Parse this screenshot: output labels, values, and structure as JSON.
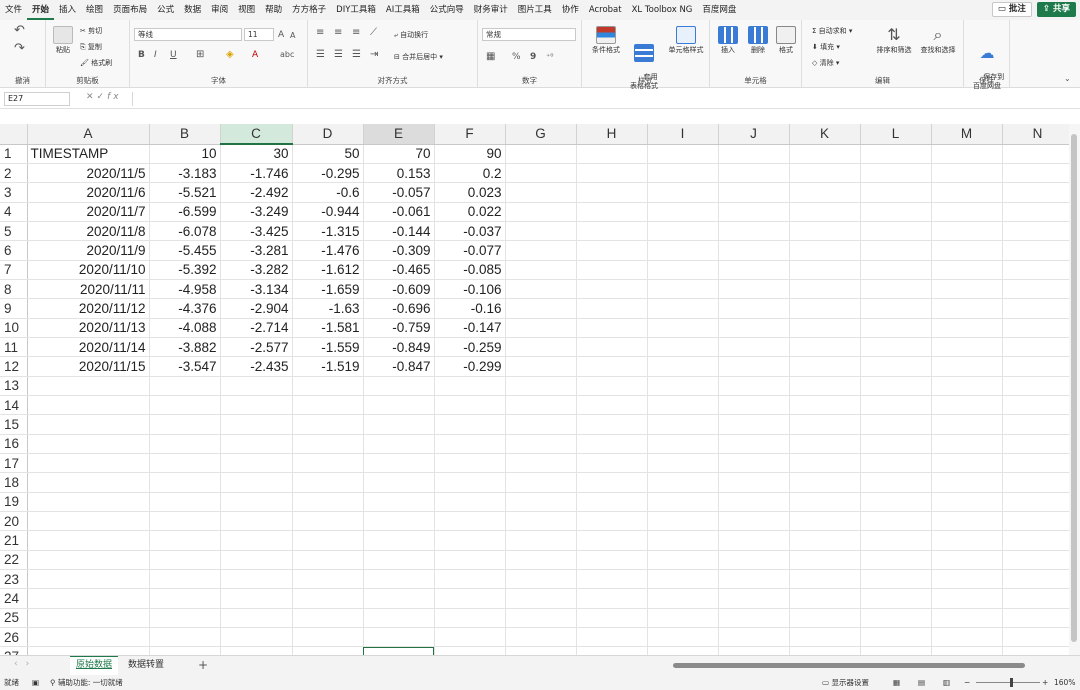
{
  "menu": {
    "tabs": [
      "文件",
      "开始",
      "插入",
      "绘图",
      "页面布局",
      "公式",
      "数据",
      "审阅",
      "视图",
      "帮助",
      "方方格子",
      "DIY工具箱",
      "AI工具箱",
      "公式向导",
      "财务审计",
      "图片工具",
      "协作",
      "Acrobat",
      "XL Toolbox NG",
      "百度网盘"
    ],
    "active": "开始",
    "comment_label": "批注",
    "share_label": "共享"
  },
  "ribbon": {
    "groups": {
      "undo": "撤消",
      "clipboard": "剪贴板",
      "font": "字体",
      "alignment": "对齐方式",
      "number": "数字",
      "styles": "样式",
      "cells": "单元格",
      "editing": "编辑",
      "save": "保存"
    },
    "clipboard": {
      "paste": "粘贴",
      "cut": "剪切",
      "copy": "复制",
      "format_painter": "格式刷"
    },
    "font": {
      "family": "等线",
      "size": "11",
      "grow": "A",
      "shrink": "A",
      "bold": "B",
      "italic": "I",
      "underline": "U",
      "color": "A"
    },
    "alignment": {
      "wrap": "自动换行",
      "merge": "合并后居中"
    },
    "number": {
      "format": "常规",
      "percent": "%",
      "comma": "9"
    },
    "styles": {
      "conditional": "条件格式",
      "table_format": "套用\n表格格式",
      "cell_styles": "单元格样式"
    },
    "cells": {
      "insert": "插入",
      "delete": "删除",
      "format": "格式"
    },
    "editing": {
      "autosum": "自动求和",
      "fill": "填充",
      "clear": "清除",
      "sort": "排序和筛选",
      "find": "查找和选择"
    },
    "save": {
      "save_to": "保存到\n百度网盘"
    }
  },
  "formula_bar": {
    "name_box": "E27",
    "fx": "fx",
    "content": ""
  },
  "columns": [
    "A",
    "B",
    "C",
    "D",
    "E",
    "F",
    "G",
    "H",
    "I",
    "J",
    "K",
    "L",
    "M",
    "N"
  ],
  "row_numbers": [
    "1",
    "2",
    "3",
    "4",
    "5",
    "6",
    "7",
    "8",
    "9",
    "10",
    "11",
    "12",
    "13",
    "14",
    "15",
    "16",
    "17",
    "18",
    "19",
    "20",
    "21",
    "22",
    "23",
    "24",
    "25",
    "26",
    "27"
  ],
  "cells": [
    [
      "TIMESTAMP",
      "10",
      "30",
      "50",
      "70",
      "90"
    ],
    [
      "2020/11/5",
      "-3.183",
      "-1.746",
      "-0.295",
      "0.153",
      "0.2"
    ],
    [
      "2020/11/6",
      "-5.521",
      "-2.492",
      "-0.6",
      "-0.057",
      "0.023"
    ],
    [
      "2020/11/7",
      "-6.599",
      "-3.249",
      "-0.944",
      "-0.061",
      "0.022"
    ],
    [
      "2020/11/8",
      "-6.078",
      "-3.425",
      "-1.315",
      "-0.144",
      "-0.037"
    ],
    [
      "2020/11/9",
      "-5.455",
      "-3.281",
      "-1.476",
      "-0.309",
      "-0.077"
    ],
    [
      "2020/11/10",
      "-5.392",
      "-3.282",
      "-1.612",
      "-0.465",
      "-0.085"
    ],
    [
      "2020/11/11",
      "-4.958",
      "-3.134",
      "-1.659",
      "-0.609",
      "-0.106"
    ],
    [
      "2020/11/12",
      "-4.376",
      "-2.904",
      "-1.63",
      "-0.696",
      "-0.16"
    ],
    [
      "2020/11/13",
      "-4.088",
      "-2.714",
      "-1.581",
      "-0.759",
      "-0.147"
    ],
    [
      "2020/11/14",
      "-3.882",
      "-2.577",
      "-1.559",
      "-0.849",
      "-0.259"
    ],
    [
      "2020/11/15",
      "-3.547",
      "-2.435",
      "-1.519",
      "-0.847",
      "-0.299"
    ]
  ],
  "sheets": {
    "tabs": [
      "原始数据",
      "数据转置"
    ],
    "active": "原始数据",
    "add": "+"
  },
  "status": {
    "ready": "就绪",
    "accessibility": "辅助功能: 一切就绪",
    "display_settings": "显示器设置",
    "zoom": "160%"
  },
  "colors": {
    "accent": "#217346",
    "selected_header": "#d3e9dc"
  }
}
